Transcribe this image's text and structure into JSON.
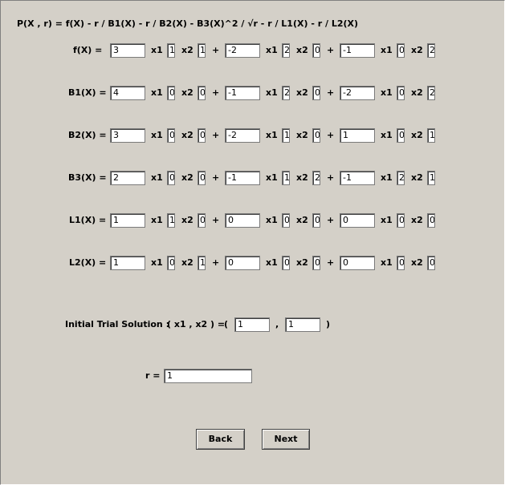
{
  "formula": "P(X , r) =  f(X)   - r / B1(X)   - r / B2(X)   - B3(X)^2 / √r   - r / L1(X)   - r / L2(X)",
  "vars": {
    "x1": "x1",
    "x2": "x2",
    "plus": "+"
  },
  "rows": [
    {
      "label": "f(X)  =",
      "terms": [
        {
          "c": "3",
          "e1": "1",
          "e2": "1"
        },
        {
          "c": "-2",
          "e1": "2",
          "e2": "0"
        },
        {
          "c": "-1",
          "e1": "0",
          "e2": "2"
        }
      ]
    },
    {
      "label": "B1(X) =",
      "terms": [
        {
          "c": "4",
          "e1": "0",
          "e2": "0"
        },
        {
          "c": "-1",
          "e1": "2",
          "e2": "0"
        },
        {
          "c": "-2",
          "e1": "0",
          "e2": "2"
        }
      ]
    },
    {
      "label": "B2(X) =",
      "terms": [
        {
          "c": "3",
          "e1": "0",
          "e2": "0"
        },
        {
          "c": "-2",
          "e1": "1",
          "e2": "0"
        },
        {
          "c": "1",
          "e1": "0",
          "e2": "1"
        }
      ]
    },
    {
      "label": "B3(X) =",
      "terms": [
        {
          "c": "2",
          "e1": "0",
          "e2": "0"
        },
        {
          "c": "-1",
          "e1": "1",
          "e2": "2"
        },
        {
          "c": "-1",
          "e1": "2",
          "e2": "1"
        }
      ]
    },
    {
      "label": "L1(X) =",
      "terms": [
        {
          "c": "1",
          "e1": "1",
          "e2": "0"
        },
        {
          "c": "0",
          "e1": "0",
          "e2": "0"
        },
        {
          "c": "0",
          "e1": "0",
          "e2": "0"
        }
      ]
    },
    {
      "label": "L2(X) =",
      "terms": [
        {
          "c": "1",
          "e1": "0",
          "e2": "1"
        },
        {
          "c": "0",
          "e1": "0",
          "e2": "0"
        },
        {
          "c": "0",
          "e1": "0",
          "e2": "0"
        }
      ]
    }
  ],
  "initial": {
    "label": "Initial Trial Solution :",
    "tuple": "( x1 , x2 ) =",
    "open": "(",
    "comma": ",",
    "close": ")",
    "x1": "1",
    "x2": "1"
  },
  "r": {
    "label": "r =",
    "value": "1"
  },
  "buttons": {
    "back": "Back",
    "next": "Next"
  }
}
